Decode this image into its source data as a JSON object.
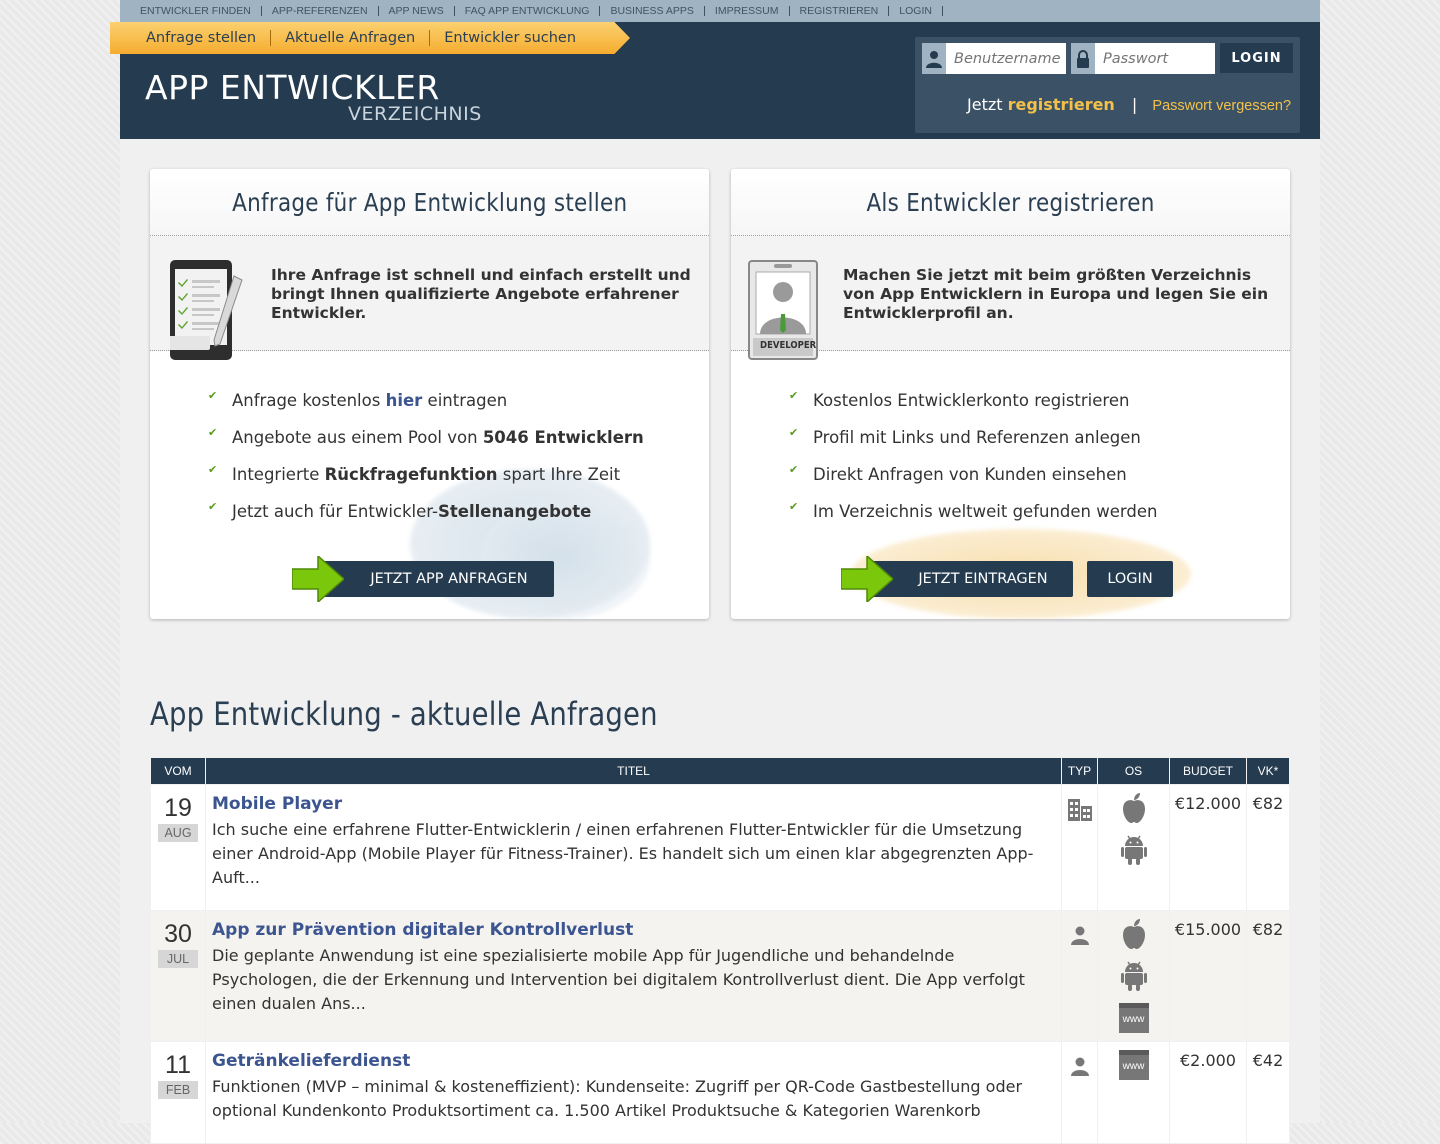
{
  "topnav": [
    "ENTWICKLER FINDEN",
    "APP-REFERENZEN",
    "APP NEWS",
    "FAQ APP ENTWICKLUNG",
    "BUSINESS APPS",
    "IMPRESSUM",
    "REGISTRIEREN",
    "LOGIN"
  ],
  "ribbon": [
    "Anfrage stellen",
    "Aktuelle Anfragen",
    "Entwickler suchen"
  ],
  "logo": {
    "top": "APP ENTWICKLER",
    "bottom": "VERZEICHNIS"
  },
  "login": {
    "username_placeholder": "Benutzername",
    "password_placeholder": "Passwort",
    "button": "LOGIN",
    "jetzt": "Jetzt",
    "register": "registrieren",
    "separator": "|",
    "forgot": "Passwort vergessen?"
  },
  "card1": {
    "title": "Anfrage für App Entwicklung stellen",
    "intro": "Ihre Anfrage ist schnell und einfach erstellt und bringt Ihnen qualifizierte Angebote erfahrener Entwickler.",
    "items": [
      {
        "pre": "Anfrage kostenlos ",
        "link": "hier",
        "post": " eintragen"
      },
      {
        "pre": "Angebote aus einem Pool von ",
        "bold": "5046 Entwicklern",
        "post": ""
      },
      {
        "pre": "Integrierte ",
        "bold": "Rückfragefunktion",
        "post": " spart Ihre Zeit"
      },
      {
        "pre": "Jetzt auch für Entwickler-",
        "bold": "Stellenangebote",
        "post": ""
      }
    ],
    "button": "JETZT APP ANFRAGEN"
  },
  "card2": {
    "title": "Als Entwickler registrieren",
    "intro": "Machen Sie jetzt mit beim größten Verzeichnis von App Entwicklern in Europa und legen Sie ein Entwicklerprofil an.",
    "badge_label": "DEVELOPER",
    "items": [
      "Kostenlos Entwicklerkonto registrieren",
      "Profil mit Links und Referenzen anlegen",
      "Direkt Anfragen von Kunden einsehen",
      "Im Verzeichnis weltweit gefunden werden"
    ],
    "button_register": "JETZT EINTRAGEN",
    "button_login": "LOGIN"
  },
  "requests": {
    "title": "App Entwicklung - aktuelle Anfragen",
    "columns": [
      "VOM",
      "TITEL",
      "TYP",
      "OS",
      "BUDGET",
      "VK*"
    ],
    "rows": [
      {
        "day": "19",
        "month": "AUG",
        "title": "Mobile Player",
        "desc": "Ich suche eine erfahrene Flutter-Entwicklerin / einen erfahrenen Flutter-Entwickler für die Umsetzung einer Android-App (Mobile Player für Fitness-Trainer). Es handelt sich um einen klar abgegrenzten App-Auft...",
        "type": "company-icon",
        "os": [
          "apple-icon",
          "android-icon"
        ],
        "budget": "€12.000",
        "vk": "€82"
      },
      {
        "day": "30",
        "month": "JUL",
        "title": "App zur Prävention digitaler Kontrollverlust",
        "desc": "Die geplante Anwendung ist eine spezialisierte mobile App für Jugendliche und behandelnde Psychologen, die der Erkennung und Intervention bei digitalem Kontrollverlust dient. Die App verfolgt einen dualen Ans...",
        "type": "person-icon",
        "os": [
          "apple-icon",
          "android-icon",
          "web-icon"
        ],
        "budget": "€15.000",
        "vk": "€82"
      },
      {
        "day": "11",
        "month": "FEB",
        "title": "Getränkelieferdienst",
        "desc": "Funktionen (MVP – minimal & kosteneffizient): Kundenseite: Zugriff per QR-Code Gastbestellung oder optional Kundenkonto Produktsortiment ca. 1.500 Artikel Produktsuche & Kategorien Warenkorb",
        "type": "person-icon",
        "os": [
          "web-icon"
        ],
        "budget": "€2.000",
        "vk": "€42"
      }
    ],
    "web_label": "www"
  },
  "colors": {
    "navy": "#243b50",
    "accent": "#f3c14a",
    "link": "#3c5590",
    "green": "#7ac70c"
  }
}
